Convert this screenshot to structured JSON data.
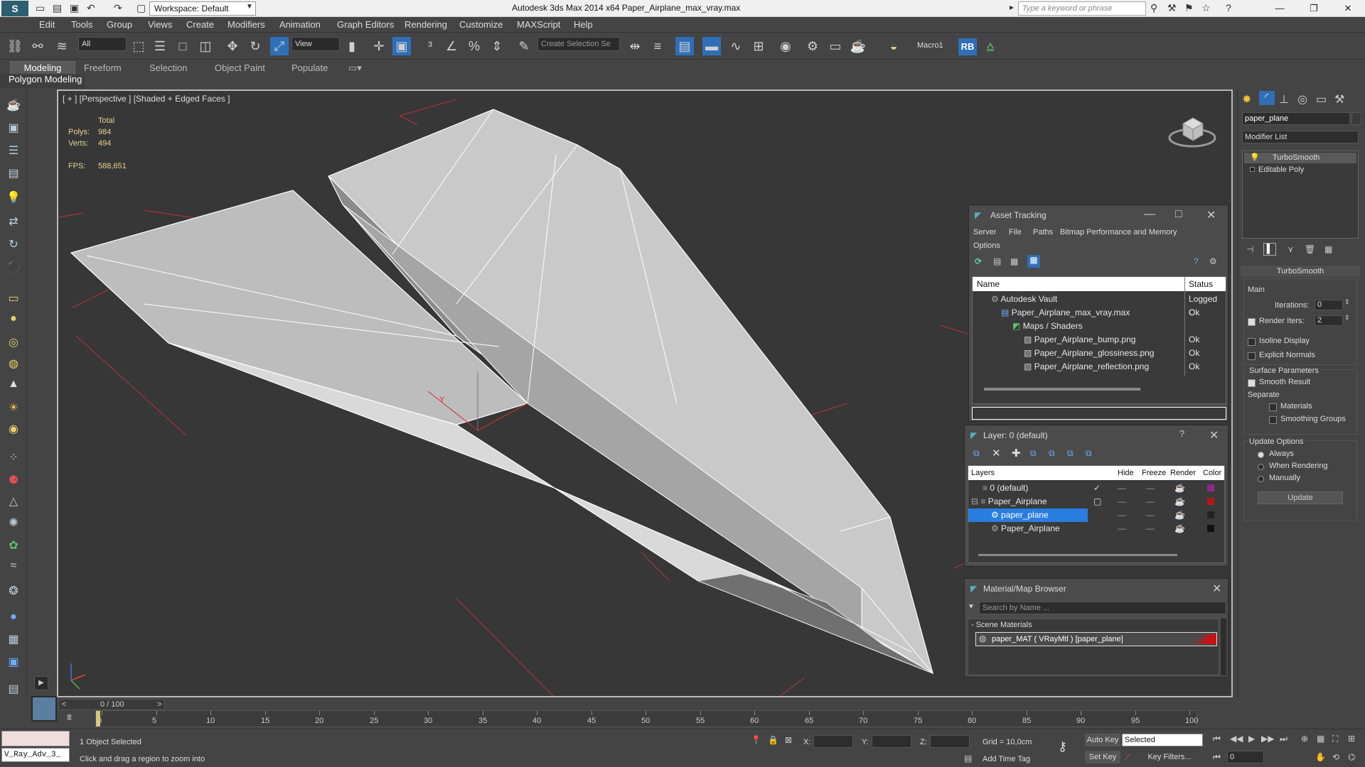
{
  "titlebar": {
    "workspace": "Workspace: Default",
    "app_title": "Autodesk 3ds Max  2014 x64     Paper_Airplane_max_vray.max",
    "search_placeholder": "Type a keyword or phrase"
  },
  "menus": [
    "Edit",
    "Tools",
    "Group",
    "Views",
    "Create",
    "Modifiers",
    "Animation",
    "Graph Editors",
    "Rendering",
    "Customize",
    "MAXScript",
    "Help"
  ],
  "toolbar": {
    "filter": "All",
    "ref_coord": "View",
    "selection_set": "Create Selection Se",
    "macro": "Macro1",
    "rb": "RB"
  },
  "ribbon": {
    "tabs": [
      "Modeling",
      "Freeform",
      "Selection",
      "Object Paint",
      "Populate"
    ],
    "panel_label": "Polygon Modeling"
  },
  "viewport": {
    "label": "[ + ] [Perspective ] [Shaded + Edged Faces ]",
    "stats": {
      "total_label": "Total",
      "polys_label": "Polys:",
      "polys": "984",
      "verts_label": "Verts:",
      "verts": "494",
      "fps_label": "FPS:",
      "fps": "588,651"
    },
    "axis_y": "Y"
  },
  "asset_tracking": {
    "title": "Asset Tracking",
    "menu": [
      "Server",
      "File",
      "Paths",
      "Bitmap Performance and Memory",
      "Options"
    ],
    "columns": [
      "Name",
      "Status"
    ],
    "rows": [
      {
        "name": "Autodesk Vault",
        "status": "Logged C"
      },
      {
        "name": "Paper_Airplane_max_vray.max",
        "status": "Ok"
      },
      {
        "name": "Maps / Shaders",
        "status": ""
      },
      {
        "name": "Paper_Airplane_bump.png",
        "status": "Ok"
      },
      {
        "name": "Paper_Airplane_glossiness.png",
        "status": "Ok"
      },
      {
        "name": "Paper_Airplane_reflection.png",
        "status": "Ok"
      }
    ]
  },
  "layers": {
    "title": "Layer: 0 (default)",
    "help": "?",
    "columns": [
      "Layers",
      "Hide",
      "Freeze",
      "Render",
      "Color"
    ],
    "rows": [
      {
        "name": "0 (default)",
        "color": "#8a2a8a"
      },
      {
        "name": "Paper_Airplane",
        "color": "#b01818"
      },
      {
        "name": "paper_plane",
        "color": "#222222"
      },
      {
        "name": "Paper_Airplane",
        "color": "#111111"
      }
    ]
  },
  "material_browser": {
    "title": "Material/Map Browser",
    "search_placeholder": "Search by Name ...",
    "group": "- Scene Materials",
    "item": "paper_MAT  ( VRayMtl )  [paper_plane]"
  },
  "command_panel": {
    "object_name": "paper_plane",
    "modifier_list": "Modifier List",
    "stack": [
      "TurboSmooth",
      "Editable Poly"
    ],
    "rollout": "TurboSmooth",
    "main": "Main",
    "iterations_label": "Iterations:",
    "iterations": "0",
    "render_iters_label": "Render Iters:",
    "render_iters": "2",
    "isoline": "Isoline Display",
    "explicit_normals": "Explicit Normals",
    "surface_params": "Surface Parameters",
    "smooth_result": "Smooth Result",
    "separate": "Separate",
    "materials": "Materials",
    "smoothing_groups": "Smoothing Groups",
    "update_options": "Update Options",
    "always": "Always",
    "when_rendering": "When Rendering",
    "manually": "Manually",
    "update_button": "Update"
  },
  "timeline": {
    "frame": "0 / 100",
    "ticks": [
      "0",
      "5",
      "10",
      "15",
      "20",
      "25",
      "30",
      "35",
      "40",
      "45",
      "50",
      "55",
      "60",
      "65",
      "70",
      "75",
      "80",
      "85",
      "90",
      "95",
      "100"
    ]
  },
  "status": {
    "script_listener": "V_Ray_Adv_3_",
    "selected": "1 Object Selected",
    "prompt": "Click and drag a region to zoom into",
    "x_label": "X:",
    "y_label": "Y:",
    "z_label": "Z:",
    "grid": "Grid = 10,0cm",
    "auto_key": "Auto Key",
    "set_key": "Set Key",
    "key_mode": "Selected",
    "key_filters": "Key Filters...",
    "add_time_tag": "Add Time Tag",
    "frame_value": "0"
  }
}
